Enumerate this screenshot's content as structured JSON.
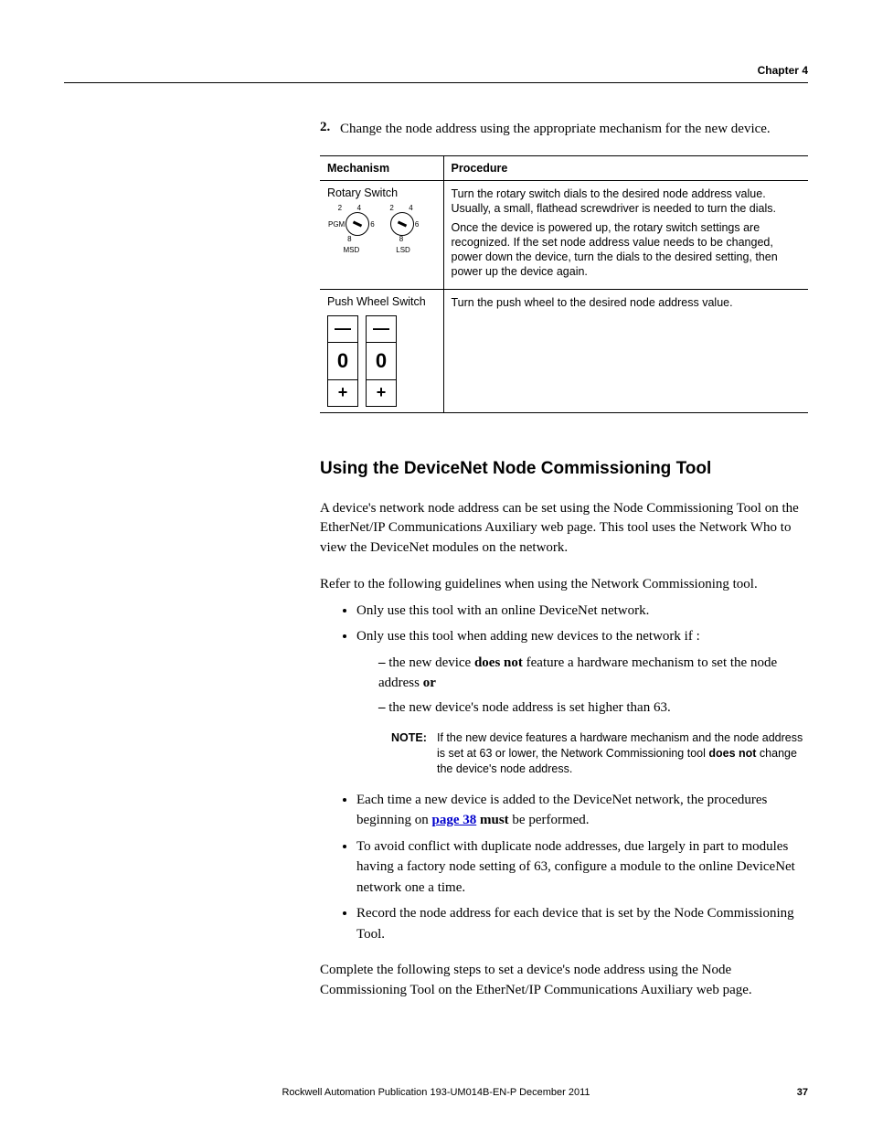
{
  "header": {
    "chapter": "Chapter 4"
  },
  "step": {
    "num": "2.",
    "text": "Change the node address using the appropriate mechanism for the new device."
  },
  "table": {
    "h1": "Mechanism",
    "h2": "Procedure",
    "r1": {
      "title": "Rotary Switch",
      "dials": {
        "pgm": "PGM",
        "msd": "MSD",
        "lsd": "LSD",
        "tick2": "2",
        "tick4": "4",
        "tick8": "8",
        "tick6": "6"
      },
      "proc1": "Turn the rotary switch dials to the desired node address value. Usually, a small, flathead screwdriver is needed to turn the dials.",
      "proc2": "Once the device is powered up, the rotary switch settings are recognized. If the set node address value needs to be changed, power down the device, turn the dials to the desired setting, then power up the device again."
    },
    "r2": {
      "title": "Push Wheel Switch",
      "digit": "0",
      "minus": "—",
      "plus": "+",
      "proc": "Turn the push wheel to the desired node address value."
    }
  },
  "section": {
    "title": "Using the DeviceNet Node Commissioning Tool",
    "p1": "A device's network node address can be set using the Node Commissioning Tool on the EtherNet/IP Communications Auxiliary web page. This tool uses the Network Who to view the DeviceNet modules on the network.",
    "p2": "Refer to the following guidelines when using the Network Commissioning tool.",
    "b1": "Only use this tool with an online DeviceNet network.",
    "b2": "Only use this tool when adding new devices to the network if :",
    "b2a_before": "the new device ",
    "b2a_bold": "does not",
    "b2a_after": " feature a hardware mechanism to set the node address ",
    "b2a_or": "or",
    "b2b": "the new device's node address is set higher than 63.",
    "note_label": "NOTE:",
    "note_before": "If the new device features a hardware mechanism and the node address is set at 63 or lower, the Network Commissioning tool ",
    "note_bold": "does not",
    "note_after": " change the device's node address.",
    "b3_before": "Each time a new device is added to the DeviceNet network, the procedures beginning on ",
    "b3_link": "page 38",
    "b3_mid": " ",
    "b3_must": "must",
    "b3_after": " be performed.",
    "b4": "To avoid conflict with duplicate node addresses, due largely in part to modules having a factory node setting of 63, configure a module to the online DeviceNet network one a time.",
    "b5": "Record the node address for each device that is set by the Node Commissioning Tool.",
    "p3": "Complete the following steps to set a device's node address using the Node Commissioning Tool on the EtherNet/IP Communications Auxiliary web page."
  },
  "footer": {
    "pub": "Rockwell Automation Publication  193-UM014B-EN-P  December 2011",
    "page": "37"
  }
}
